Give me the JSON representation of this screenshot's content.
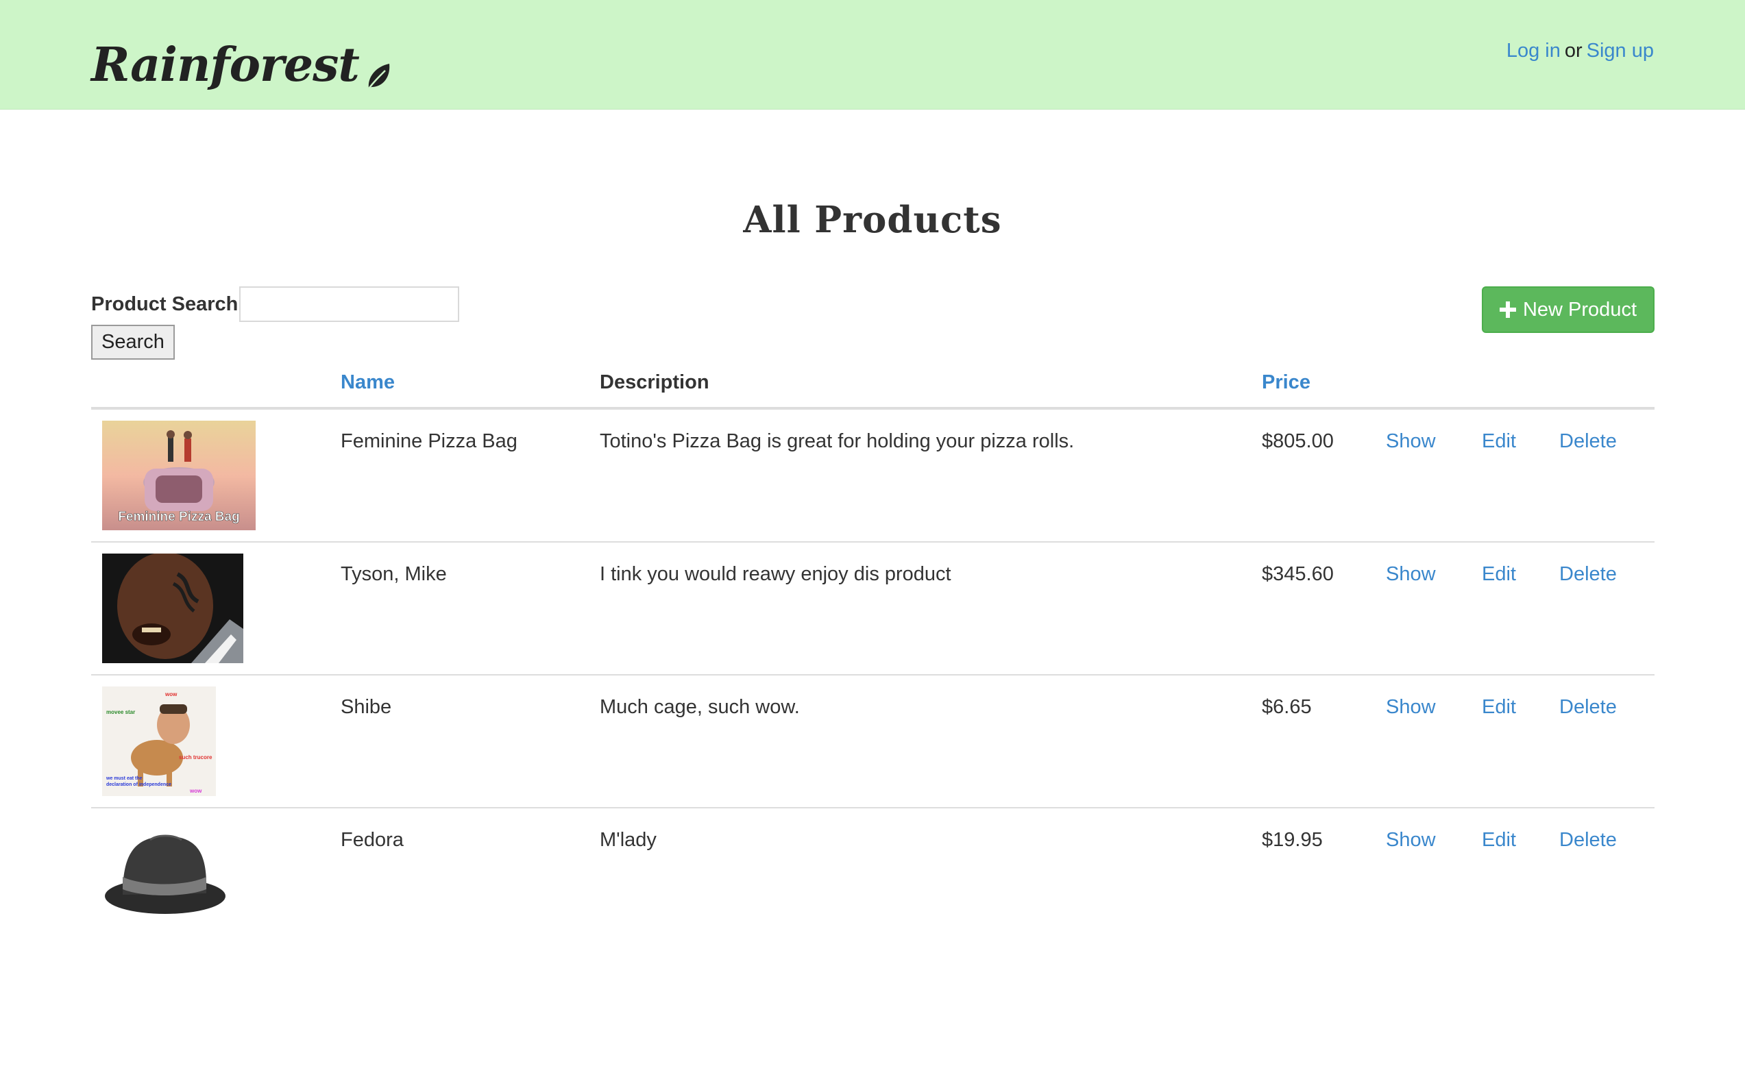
{
  "header": {
    "brand": "Rainforest",
    "login": "Log in",
    "or": "or",
    "signup": "Sign up"
  },
  "page": {
    "title": "All Products"
  },
  "search": {
    "label": "Product Search",
    "value": "",
    "button": "Search"
  },
  "new_product": "New Product",
  "table": {
    "headers": {
      "image": "",
      "name": "Name",
      "description": "Description",
      "price": "Price"
    },
    "rows": [
      {
        "name": "Feminine Pizza Bag",
        "description": "Totino's Pizza Bag is great for holding your pizza rolls.",
        "price": "$805.00",
        "show": "Show",
        "edit": "Edit",
        "delete": "Delete",
        "image_caption": "Feminine Pizza Bag"
      },
      {
        "name": "Tyson, Mike",
        "description": "I tink you would reawy enjoy dis product",
        "price": "$345.60",
        "show": "Show",
        "edit": "Edit",
        "delete": "Delete"
      },
      {
        "name": "Shibe",
        "description": "Much cage, such wow.",
        "price": "$6.65",
        "show": "Show",
        "edit": "Edit",
        "delete": "Delete",
        "image_texts": {
          "t1": "wow",
          "t2": "movee star",
          "t3": "such trucore",
          "t4": "we must eat the",
          "t5": "declaration of independence",
          "t6": "wow"
        }
      },
      {
        "name": "Fedora",
        "description": "M'lady",
        "price": "$19.95",
        "show": "Show",
        "edit": "Edit",
        "delete": "Delete"
      }
    ]
  },
  "colors": {
    "navbar": "#cdf5c8",
    "link": "#3a87cc",
    "success": "#5cb85c"
  }
}
